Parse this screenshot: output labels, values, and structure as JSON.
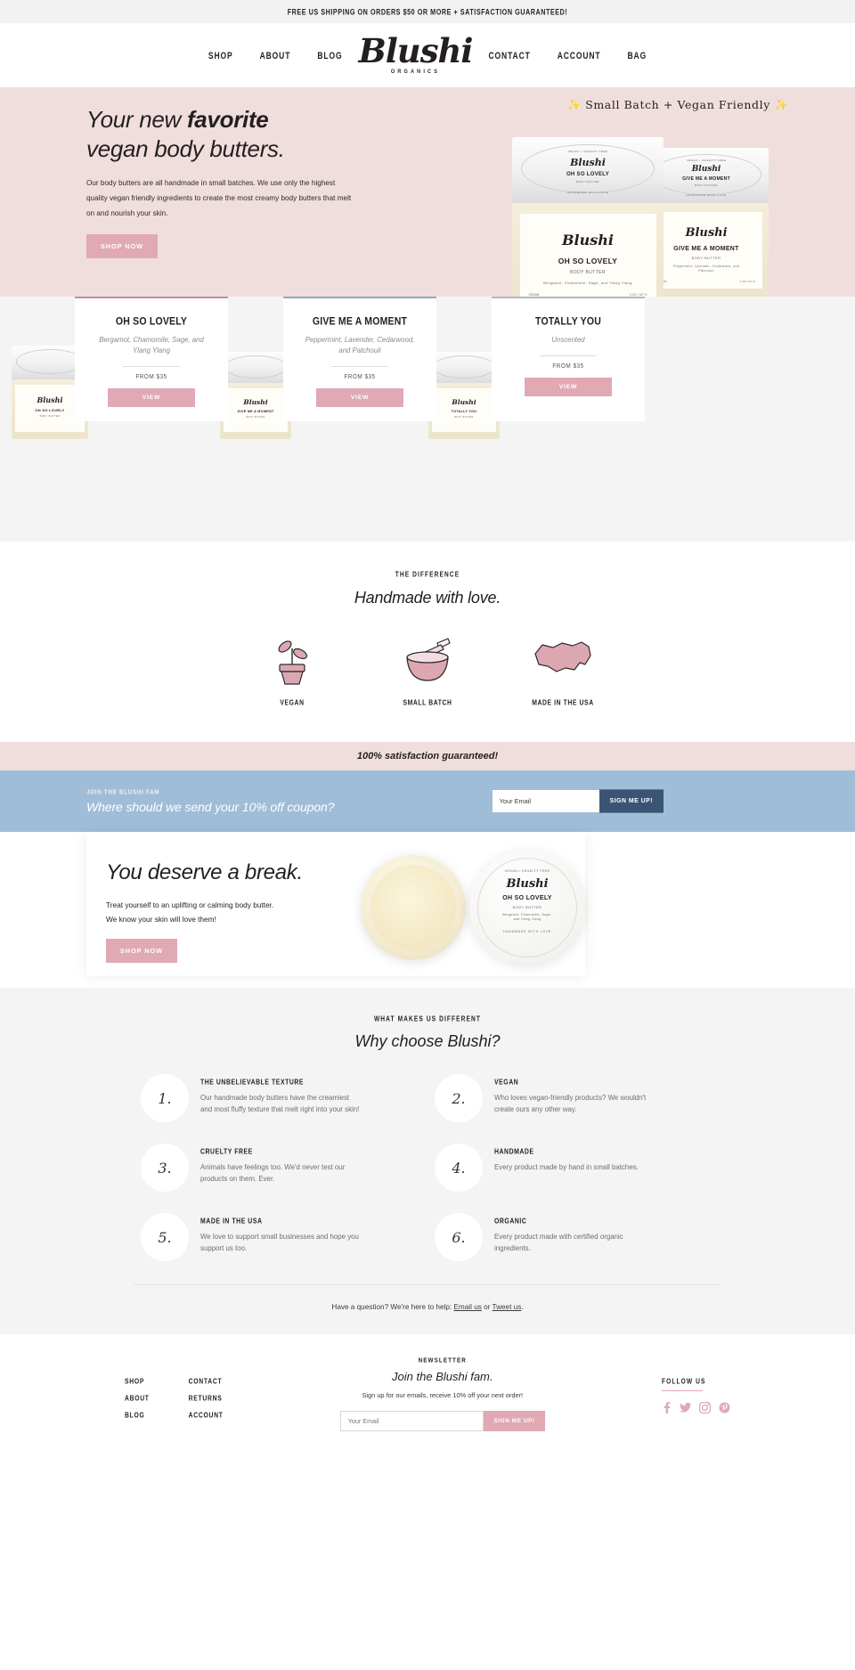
{
  "announcement": {
    "text": "FREE US SHIPPING ON ORDERS $50 OR MORE + SATISFACTION GUARANTEED!"
  },
  "header": {
    "nav_left": [
      {
        "label": "SHOP"
      },
      {
        "label": "ABOUT"
      },
      {
        "label": "BLOG"
      }
    ],
    "nav_right": [
      {
        "label": "CONTACT"
      },
      {
        "label": "ACCOUNT"
      },
      {
        "label": "BAG"
      }
    ],
    "logo": {
      "name": "Blushi",
      "tagline": "ORGANICS"
    }
  },
  "hero": {
    "heading_line1_pre": "Your new ",
    "heading_line1_bold": "favorite",
    "heading_line2": "vegan body butters.",
    "body": "Our body butters are all handmade in small batches. We use only the highest quality vegan friendly ingredients to create the most creamy body butters that melt on and nourish your skin.",
    "cta": "SHOP NOW",
    "tagline": "Small Batch + Vegan Friendly",
    "spark": "✨",
    "bg_color": "#f0dedd",
    "jars": [
      {
        "brand": "Blushi",
        "title": "OH SO LOVELY",
        "subtitle": "BODY BUTTER",
        "notes": "Bergamot, Chamomile, Sage, and Ylang Ylang",
        "top_text": "VEGAN + CRUELTY FREE",
        "bottom_text": "HANDMADE WITH LOVE",
        "size": "4 OZ / 167 G",
        "vegan_badge": "VEGAN"
      },
      {
        "brand": "Blushi",
        "title": "GIVE ME A MOMENT",
        "subtitle": "BODY BUTTER",
        "notes": "Peppermint, Lavender, Cedarwood, and Patchouli",
        "top_text": "VEGAN + CRUELTY FREE",
        "bottom_text": "HANDMADE WITH LOVE",
        "size": "4 OZ / 167 G",
        "vegan_badge": "VEGAN"
      }
    ]
  },
  "products": {
    "items": [
      {
        "name": "OH SO LOVELY",
        "notes": "Bergamot, Chamomile, Sage, and Ylang Ylang",
        "price_label": "FROM $35",
        "cta": "VIEW",
        "accent": "#c08e9c"
      },
      {
        "name": "GIVE ME A MOMENT",
        "notes": "Peppermint, Lavender, Cedarwood, and Patchouli",
        "price_label": "FROM $35",
        "cta": "VIEW",
        "accent": "#8aa9c4"
      },
      {
        "name": "TOTALLY YOU",
        "notes": "Unscented",
        "price_label": "FROM $35",
        "cta": "VIEW",
        "accent": "#b8b8b8"
      }
    ]
  },
  "difference": {
    "eyebrow": "THE DIFFERENCE",
    "heading": "Handmade with love.",
    "features": [
      {
        "icon": "plant-pot-icon",
        "label": "VEGAN"
      },
      {
        "icon": "mortar-pestle-icon",
        "label": "SMALL BATCH"
      },
      {
        "icon": "usa-map-icon",
        "label": "MADE IN THE USA"
      }
    ]
  },
  "satisfaction": {
    "text": "100% satisfaction guaranteed!",
    "bg_color": "#f0dedd"
  },
  "newsletter_band": {
    "eyebrow": "JOIN THE BLUSHI FAM",
    "heading": "Where should we send your 10% off coupon?",
    "input_placeholder": "Your Email",
    "input_value": "",
    "button": "SIGN ME UP!",
    "bg_color": "#a0bdd8",
    "button_color": "#3a5574"
  },
  "break_section": {
    "heading": "You deserve a break.",
    "line1": "Treat yourself to an uplifting or calming body butter.",
    "line2": "We know your skin will love them!",
    "cta": "SHOP NOW",
    "jar_label": {
      "top_text": "VEGAN • CRUELTY FREE",
      "brand": "Blushi",
      "title": "OH SO LOVELY",
      "subtitle": "BODY BUTTER",
      "notes": "Bergamot, Chamomile, Sage, and Ylang Ylang",
      "bottom_text": "HANDMADE WITH LOVE"
    }
  },
  "why": {
    "eyebrow": "WHAT MAKES US DIFFERENT",
    "heading": "Why choose Blushi?",
    "items": [
      {
        "num": "1.",
        "title": "THE UNBELIEVABLE TEXTURE",
        "body": "Our handmade body butters have the creamiest and most fluffy texture that melt right into your skin!"
      },
      {
        "num": "2.",
        "title": "VEGAN",
        "body": "Who loves vegan-friendly products? We wouldn't create ours any other way."
      },
      {
        "num": "3.",
        "title": "CRUELTY FREE",
        "body": "Animals have feelings too. We'd never test our products on them. Ever."
      },
      {
        "num": "4.",
        "title": "HANDMADE",
        "body": "Every product made by hand in small batches."
      },
      {
        "num": "5.",
        "title": "MADE IN THE USA",
        "body": "We love to support small businesses and hope you support us too."
      },
      {
        "num": "6.",
        "title": "ORGANIC",
        "body": "Every product made with certified organic ingredients."
      }
    ],
    "help_prefix": "Have a question? We're here to help: ",
    "help_link1": "Email us",
    "help_middle": " or ",
    "help_link2": "Tweet us",
    "help_suffix": "."
  },
  "footer": {
    "col1": [
      {
        "label": "SHOP"
      },
      {
        "label": "ABOUT"
      },
      {
        "label": "BLOG"
      }
    ],
    "col2": [
      {
        "label": "CONTACT"
      },
      {
        "label": "RETURNS"
      },
      {
        "label": "ACCOUNT"
      }
    ],
    "newsletter": {
      "eyebrow": "NEWSLETTER",
      "heading": "Join the Blushi fam.",
      "body": "Sign up for our emails, receive 10% off your next order!",
      "input_placeholder": "Your Email",
      "input_value": "",
      "button": "SIGN ME UP!"
    },
    "follow": {
      "eyebrow": "FOLLOW US",
      "socials": [
        {
          "icon": "facebook-icon",
          "glyph": "f"
        },
        {
          "icon": "twitter-icon",
          "glyph": "🐦"
        },
        {
          "icon": "instagram-icon",
          "glyph": "◙"
        },
        {
          "icon": "pinterest-icon",
          "glyph": "P"
        }
      ]
    }
  }
}
